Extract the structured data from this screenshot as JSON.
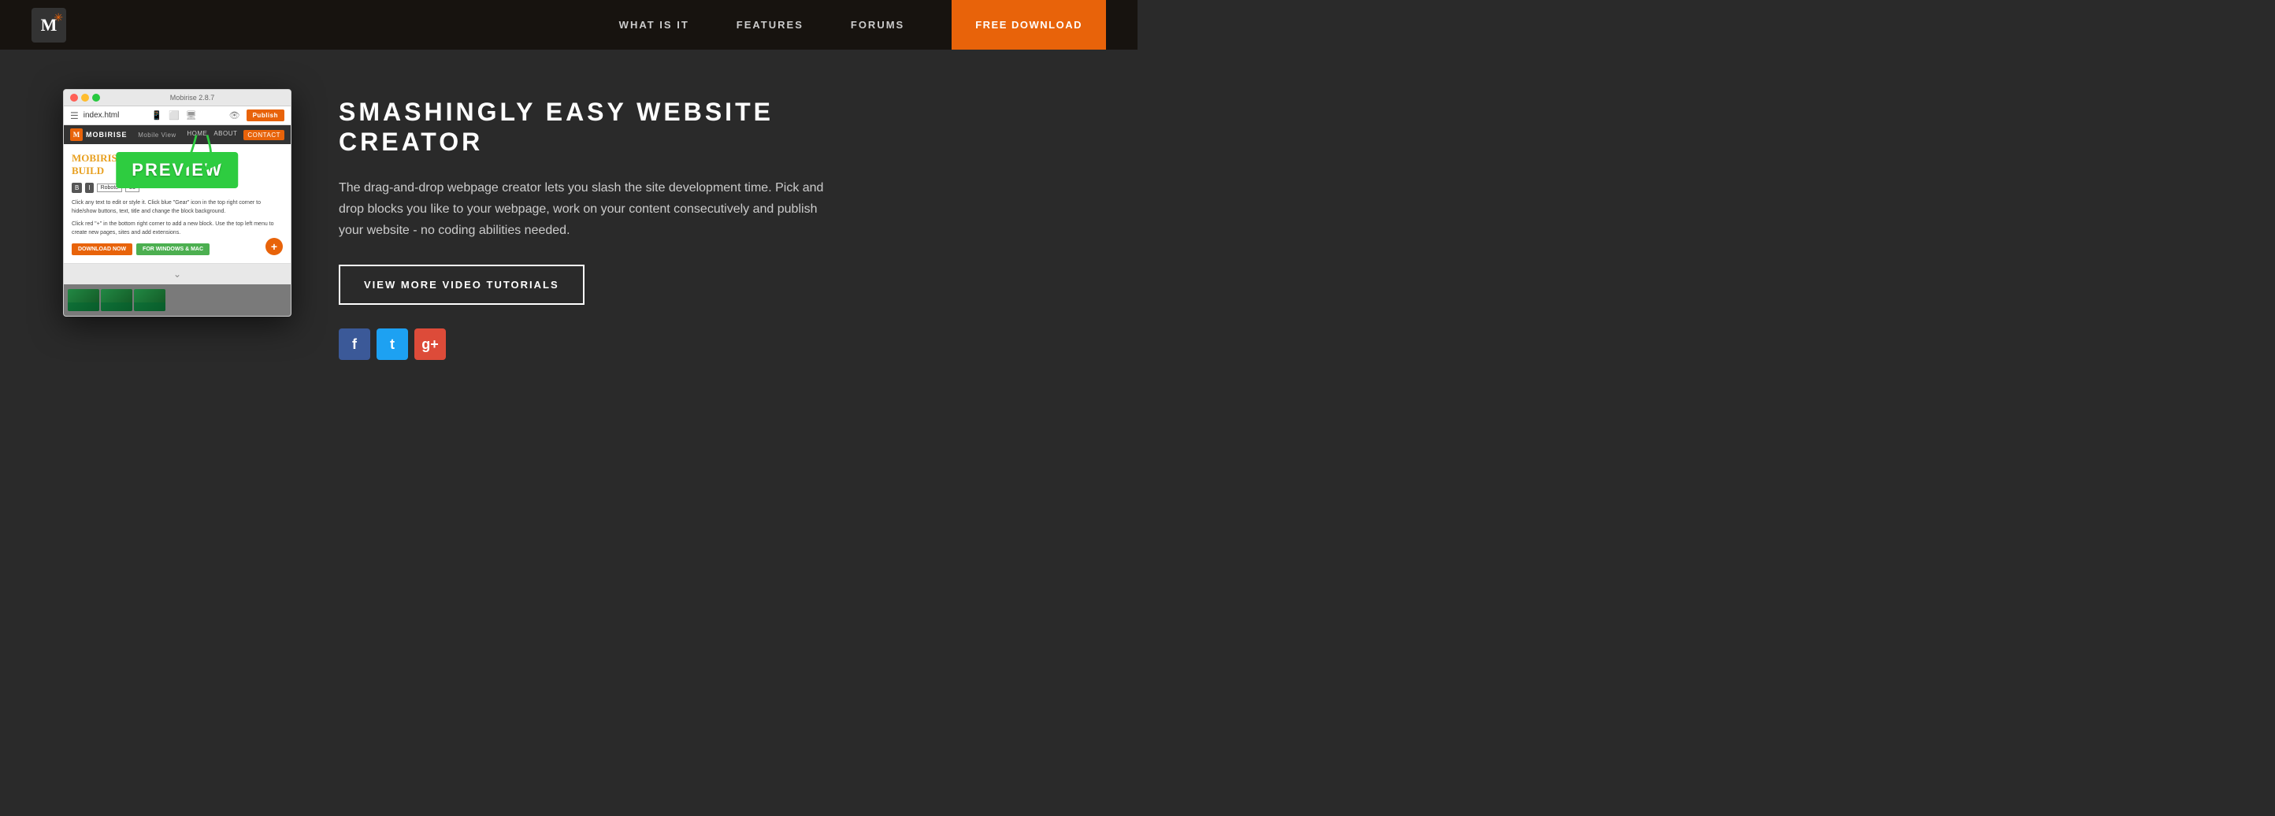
{
  "navbar": {
    "logo_letter": "M",
    "nav_items": [
      {
        "id": "what-is-it",
        "label": "WHAT IS IT"
      },
      {
        "id": "features",
        "label": "FEATURES"
      },
      {
        "id": "forums",
        "label": "FORUMS"
      }
    ],
    "download_btn": "FREE DOWNLOAD"
  },
  "app_window": {
    "title": "Mobirise 2.8.7",
    "file_name": "index.html",
    "mobile_view_label": "Mobile View",
    "brand_name": "MOBIRISE",
    "nav_items": [
      "HOME",
      "ABOUT",
      "CONTACT"
    ],
    "publish_btn": "Publish",
    "preview_label": "PREVIEW",
    "headline_line1": "MOBIRISE WEBSITE",
    "headline_line2": "BUILD",
    "body_text_1": "Click any text to edit or style it. Click blue \"Gear\" icon in the top right corner to hide/show buttons, text, title and change the block background.",
    "body_text_2": "Click red \"+\" in the bottom right corner to add a new block. Use the top left menu to create new pages, sites and add extensions.",
    "btn_download": "DOWNLOAD NOW",
    "btn_windows": "FOR WINDOWS & MAC"
  },
  "main": {
    "title_line1": "SMASHINGLY EASY WEBSITE",
    "title_line2": "CREATOR",
    "description": "The drag-and-drop webpage creator lets you slash the site development time. Pick and drop blocks you like to your webpage, work on your content consecutively and publish your website - no coding abilities needed.",
    "video_btn": "VIEW MORE VIDEO TUTORIALS",
    "social": [
      {
        "name": "facebook",
        "symbol": "f"
      },
      {
        "name": "twitter",
        "symbol": "t"
      },
      {
        "name": "google-plus",
        "symbol": "g+"
      }
    ]
  },
  "bottom_section": {
    "platforms": "For Windows Mac"
  }
}
